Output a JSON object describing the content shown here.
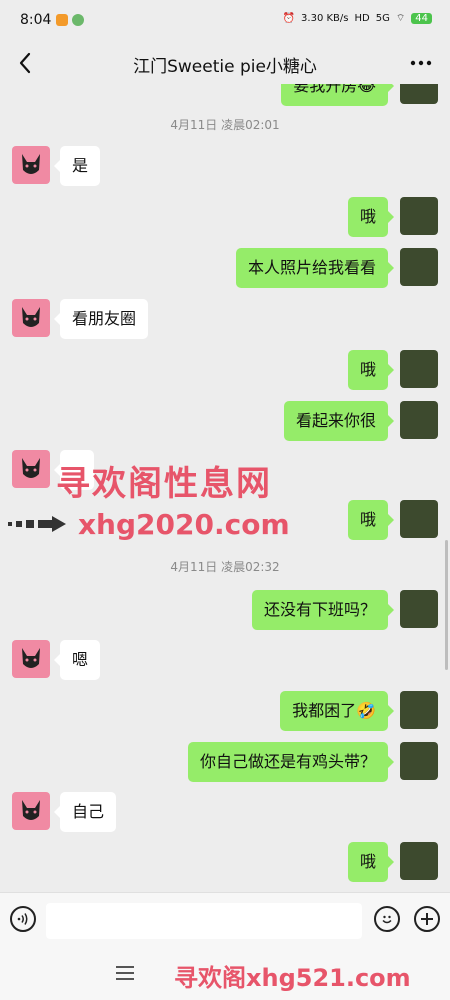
{
  "status": {
    "time": "8:04",
    "net_speed": "3.30 KB/s",
    "hd": "HD",
    "signal": "5G",
    "battery": "44"
  },
  "header": {
    "back_label": "<",
    "title": "江门Sweetie pie小糖心",
    "more_label": "···"
  },
  "chat": {
    "top_partial_text": "要我开房😂",
    "timestamp1": "4月11日 凌晨02:01",
    "timestamp2": "4月11日 凌晨02:32",
    "messages": [
      {
        "side": "left",
        "text": "是"
      },
      {
        "side": "right",
        "text": "哦"
      },
      {
        "side": "right",
        "text": "本人照片给我看看"
      },
      {
        "side": "left",
        "text": "看朋友圈"
      },
      {
        "side": "right",
        "text": "哦"
      },
      {
        "side": "right",
        "text": "看起来你很"
      },
      {
        "side": "left",
        "text": ""
      },
      {
        "side": "right",
        "text": "哦"
      },
      {
        "side": "right",
        "text": "还没有下班吗？"
      },
      {
        "side": "left",
        "text": "嗯"
      },
      {
        "side": "right",
        "text": "我都困了🤣"
      },
      {
        "side": "right",
        "text": "你自己做还是有鸡头带？"
      },
      {
        "side": "left",
        "text": "自己"
      },
      {
        "side": "right",
        "text": "哦"
      }
    ]
  },
  "watermark": {
    "line1": "寻欢阁性息网",
    "line2": "xhg2020.com",
    "line3": "寻欢阁xhg521.com"
  },
  "colors": {
    "background": "#ededed",
    "right_bubble": "#95ec69",
    "left_bubble": "#ffffff",
    "watermark": "#e7556a"
  }
}
